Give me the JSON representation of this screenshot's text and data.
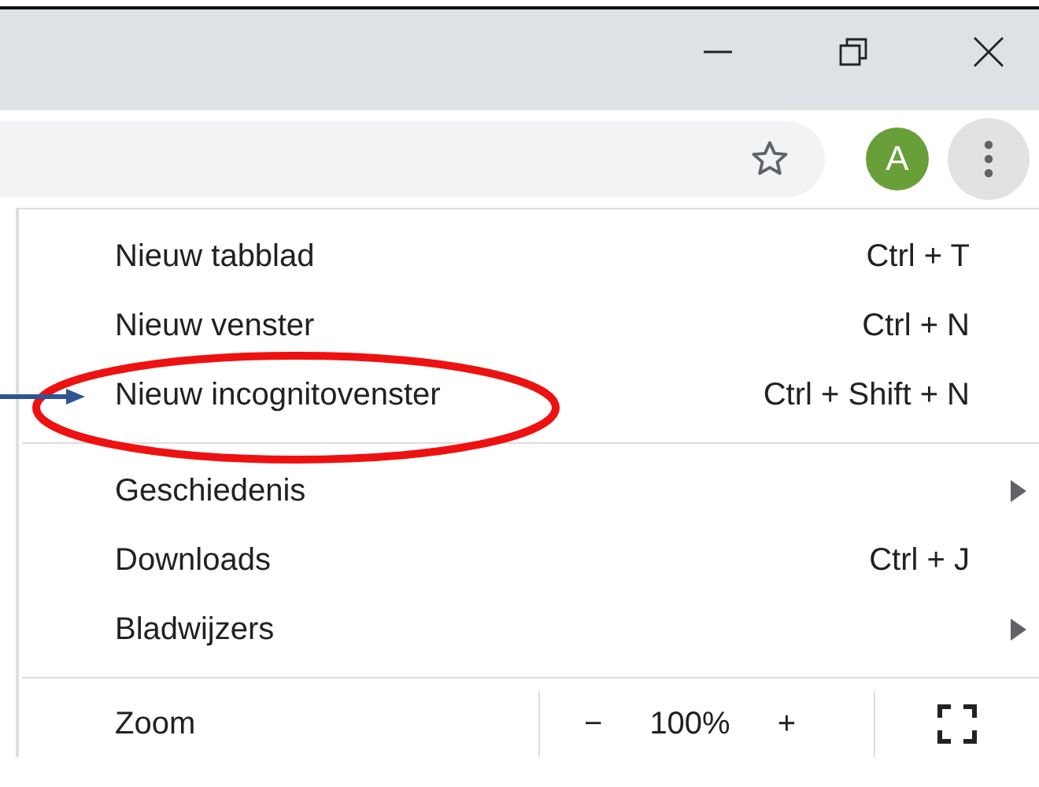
{
  "toolbar": {
    "avatar_letter": "A"
  },
  "menu": {
    "sections": [
      {
        "items": [
          {
            "kind": "command",
            "label": "Nieuw tabblad",
            "shortcut": "Ctrl + T"
          },
          {
            "kind": "command",
            "label": "Nieuw venster",
            "shortcut": "Ctrl + N"
          },
          {
            "kind": "command",
            "label": "Nieuw incognitovenster",
            "shortcut": "Ctrl + Shift + N"
          }
        ]
      },
      {
        "items": [
          {
            "kind": "submenu",
            "label": "Geschiedenis"
          },
          {
            "kind": "command",
            "label": "Downloads",
            "shortcut": "Ctrl + J"
          },
          {
            "kind": "submenu",
            "label": "Bladwijzers"
          }
        ]
      }
    ],
    "zoom": {
      "label": "Zoom",
      "minus": "−",
      "value": "100%",
      "plus": "+"
    }
  }
}
